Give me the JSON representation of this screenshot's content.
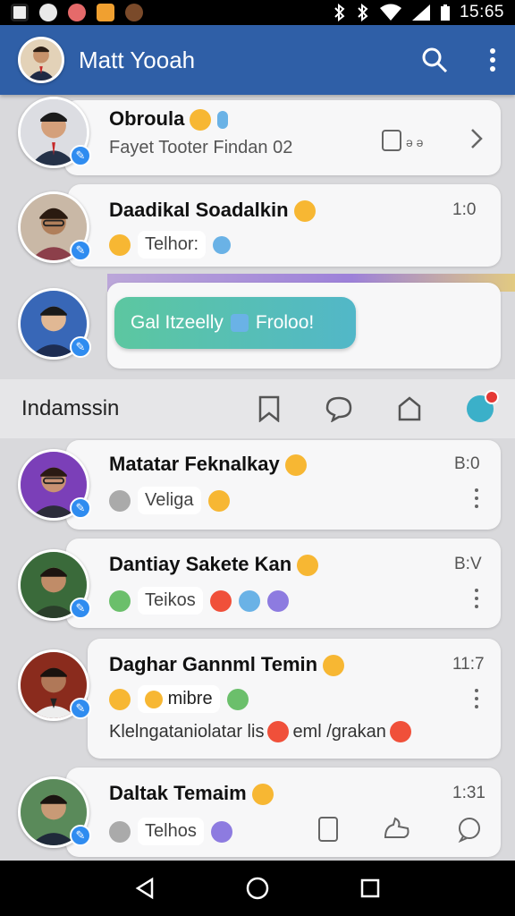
{
  "status_bar": {
    "time": "15:65"
  },
  "app_bar": {
    "title": "Matt Yooah"
  },
  "chats": [
    {
      "name": "Obroula",
      "subtitle": "Fayet Tooter Findan 02",
      "time": ""
    },
    {
      "name": "Daadikal Soadalkin",
      "subtitle": "Telhor:",
      "time": "1:0"
    },
    {
      "name": "",
      "subtitle": "",
      "time": ""
    }
  ],
  "bubble": {
    "text": "Gal Itzeelly",
    "label": "Froloo!"
  },
  "section": {
    "label": "Indamssin"
  },
  "chats2": [
    {
      "name": "Matatar Feknalkay",
      "subtitle": "Veliga",
      "time": "B:0"
    },
    {
      "name": "Dantiay Sakete Kan",
      "subtitle": "Teikos",
      "time": "B:V"
    },
    {
      "name": "Daghar Gannml Temin",
      "subtitle": "mibre",
      "time": "11:7",
      "preview": "Klelngataniolatar lis",
      "preview2": "eml /grakan"
    },
    {
      "name": "Daltak Temaim",
      "subtitle": "Telhos",
      "time": "1:31"
    }
  ],
  "icons": {
    "search": "search-icon",
    "menu": "more-vert-icon"
  }
}
